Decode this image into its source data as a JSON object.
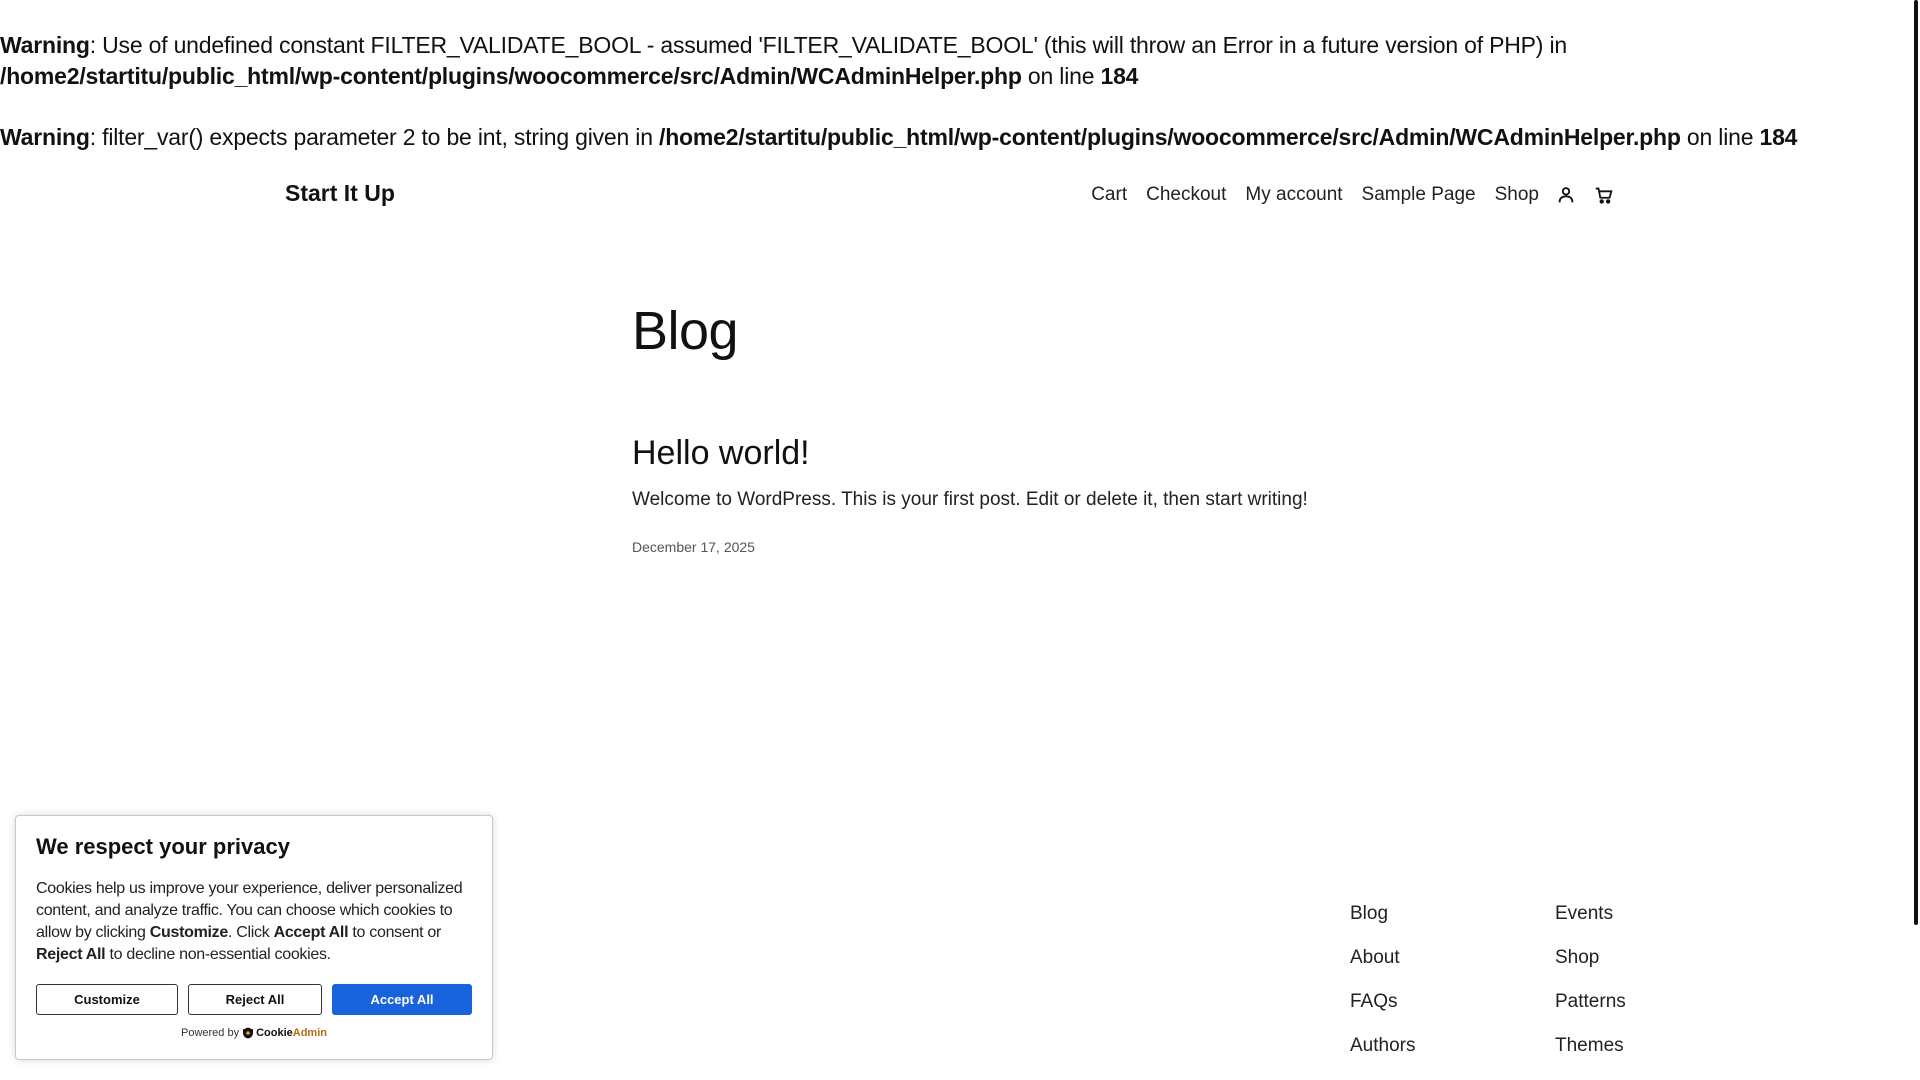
{
  "warnings": [
    {
      "label": "Warning",
      "message": ": Use of undefined constant FILTER_VALIDATE_BOOL - assumed 'FILTER_VALIDATE_BOOL' (this will throw an Error in a future version of PHP) in ",
      "path": "/home2/startitu/public_html/wp-content/plugins/woocommerce/src/Admin/WCAdminHelper.php",
      "on_line": " on line ",
      "line": "184"
    },
    {
      "label": "Warning",
      "message": ": filter_var() expects parameter 2 to be int, string given in ",
      "path": "/home2/startitu/public_html/wp-content/plugins/woocommerce/src/Admin/WCAdminHelper.php",
      "on_line": " on line ",
      "line": "184"
    }
  ],
  "header": {
    "site_title": "Start It Up",
    "nav": [
      "Cart",
      "Checkout",
      "My account",
      "Sample Page",
      "Shop"
    ],
    "icons": [
      "account-icon",
      "cart-icon"
    ]
  },
  "main": {
    "page_title": "Blog",
    "posts": [
      {
        "title": "Hello world!",
        "excerpt": "Welcome to WordPress. This is your first post. Edit or delete it, then start writing!",
        "date": "December 17, 2025"
      }
    ]
  },
  "footer": {
    "col1": [
      "Blog",
      "About",
      "FAQs",
      "Authors"
    ],
    "col2": [
      "Events",
      "Shop",
      "Patterns",
      "Themes"
    ]
  },
  "cookie_banner": {
    "title": "We respect your privacy",
    "text_1": "Cookies help us improve your experience, deliver personalized content, and analyze traffic. You can choose which cookies to allow by clicking ",
    "bold_1": "Customize",
    "text_2": ". Click ",
    "bold_2": "Accept All",
    "text_3": " to consent or ",
    "bold_3": "Reject All",
    "text_4": " to decline non-essential cookies.",
    "customize_label": "Customize",
    "reject_label": "Reject All",
    "accept_label": "Accept All",
    "powered_by": "Powered by",
    "brand_cookie": "Cookie",
    "brand_admin": "Admin",
    "accent_color": "#1863dc"
  }
}
